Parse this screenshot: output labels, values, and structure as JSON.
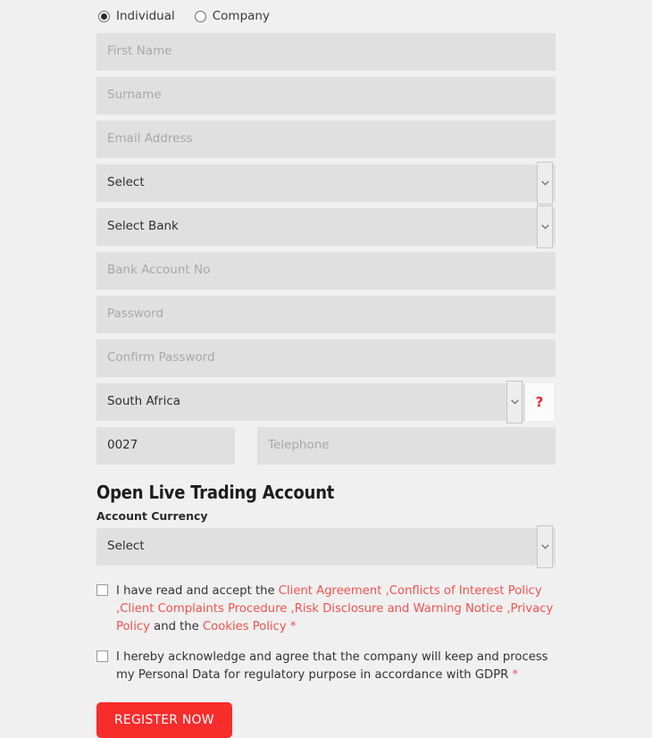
{
  "account_type": {
    "options": [
      {
        "label": "Individual",
        "selected": true
      },
      {
        "label": "Company",
        "selected": false
      }
    ]
  },
  "fields": {
    "first_name_placeholder": "First Name",
    "surname_placeholder": "Surname",
    "email_placeholder": "Email Address",
    "country_of_residence_value": "Select",
    "bank_value": "Select Bank",
    "bank_account_placeholder": "Bank Account No",
    "password_placeholder": "Password",
    "confirm_password_placeholder": "Confirm Password",
    "country_value": "South Africa",
    "help_icon_label": "?",
    "dial_code_value": "0027",
    "telephone_placeholder": "Telephone"
  },
  "live_account": {
    "title": "Open Live Trading Account",
    "currency_label": "Account Currency",
    "currency_value": "Select"
  },
  "consents": {
    "terms": {
      "intro": "I have read and accept the ",
      "links": [
        "Client Agreement",
        "Conflicts of Interest Policy",
        "Client Complaints Procedure",
        "Risk Disclosure and Warning Notice",
        "Privacy Policy"
      ],
      "separator": " ,",
      "conjunction": " and the ",
      "last_link": "Cookies Policy",
      "required_mark": " *"
    },
    "gdpr": {
      "text": "I hereby acknowledge and agree that the company will keep and process my Personal Data for regulatory purpose in accordance with GDPR",
      "required_mark": " *"
    }
  },
  "submit": {
    "label": "REGISTER NOW"
  },
  "colors": {
    "page_background": "#f0f0f0",
    "field_background": "#e0e0e0",
    "placeholder_text": "#a8a8a8",
    "link_red": "#ef5350",
    "button_red": "#f92c2c",
    "help_red": "#e8252a"
  }
}
